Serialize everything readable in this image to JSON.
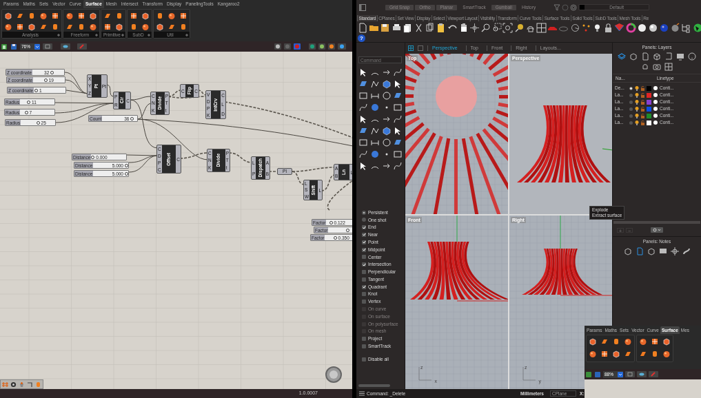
{
  "gh": {
    "tabs": [
      {
        "label": "Params",
        "selected": false
      },
      {
        "label": "Maths",
        "selected": false
      },
      {
        "label": "Sets",
        "selected": false
      },
      {
        "label": "Vector",
        "selected": false
      },
      {
        "label": "Curve",
        "selected": false
      },
      {
        "label": "Surface",
        "selected": true
      },
      {
        "label": "Mesh",
        "selected": false
      },
      {
        "label": "Intersect",
        "selected": false
      },
      {
        "label": "Transform",
        "selected": false
      },
      {
        "label": "Display",
        "selected": false
      },
      {
        "label": "PanelingTools",
        "selected": false
      },
      {
        "label": "Kangaroo2",
        "selected": false
      }
    ],
    "ribbon_groups": [
      {
        "label": "Analysis"
      },
      {
        "label": "Freeform"
      },
      {
        "label": "Primitive"
      },
      {
        "label": "SubD"
      },
      {
        "label": "Util"
      }
    ],
    "zoom": "76%",
    "sliders": [
      {
        "label": "Z coordinate",
        "value": "32",
        "level": 0.64
      },
      {
        "label": "Z coordinate",
        "value": "19",
        "level": 0.38
      },
      {
        "label": "Z coordinate",
        "value": "1",
        "level": 0.02
      },
      {
        "label": "Radius",
        "value": "11",
        "level": 0.22
      },
      {
        "label": "Radius",
        "value": "7",
        "level": 0.14
      },
      {
        "label": "Radius",
        "value": "25",
        "level": 0.5
      },
      {
        "label": "Count",
        "value": "36",
        "level": 0.9
      },
      {
        "label": "Distance",
        "value": "0.000",
        "level": 0
      },
      {
        "label": "Distance",
        "value": "5.000",
        "level": 1
      },
      {
        "label": "Distance",
        "value": "5.000",
        "level": 1
      },
      {
        "label": "Factor",
        "value": "0.122",
        "level": 0.12
      },
      {
        "label": "Factor",
        "level": 0.85
      },
      {
        "label": "Factor",
        "value": "0.350",
        "level": 0.35
      }
    ],
    "components": [
      {
        "kind": "component",
        "name": "Pt",
        "inputs": [
          "X",
          "Y",
          "Z"
        ],
        "outputs": [
          "Pt"
        ]
      },
      {
        "kind": "component",
        "name": "Cir",
        "inputs": [
          "P",
          "R"
        ],
        "outputs": [
          "C"
        ]
      },
      {
        "kind": "component",
        "name": "Divide",
        "inputs": [
          "C",
          "N",
          "K"
        ],
        "outputs": [
          "P",
          "T",
          "t"
        ]
      },
      {
        "kind": "component",
        "name": "Flip",
        "inputs": [
          "C"
        ],
        "outputs": [
          "C"
        ]
      },
      {
        "kind": "component",
        "name": "IntCrv",
        "inputs": [
          "V",
          "D",
          "P",
          "K"
        ],
        "outputs": [
          "C",
          "L",
          "D"
        ]
      },
      {
        "kind": "component",
        "name": "Offset",
        "inputs": [
          "C",
          "D",
          "P",
          "C"
        ],
        "outputs": [
          "C"
        ]
      },
      {
        "kind": "component",
        "name": "Divide",
        "inputs": [
          "C",
          "N",
          "K"
        ],
        "outputs": [
          "P",
          "T",
          "t"
        ]
      },
      {
        "kind": "component",
        "name": "Dispatch",
        "inputs": [
          "L",
          "P"
        ],
        "outputs": [
          "A",
          "B"
        ]
      },
      {
        "kind": "param",
        "name": "Pl"
      },
      {
        "kind": "component",
        "name": "Shift",
        "inputs": [
          "L",
          "S",
          "W"
        ],
        "outputs": [
          "L"
        ]
      },
      {
        "kind": "component",
        "name": "Ln",
        "inputs": [
          "A",
          "B"
        ],
        "outputs": [
          "L"
        ]
      }
    ],
    "version": "1.0.0007"
  },
  "rhino": {
    "toggles": [
      {
        "label": "Grid Snap",
        "on": true
      },
      {
        "label": "Ortho",
        "on": true
      },
      {
        "label": "Planar",
        "on": true
      },
      {
        "label": "SmartTrack",
        "on": false
      },
      {
        "label": "Gumball",
        "on": true
      },
      {
        "label": "History",
        "on": false
      }
    ],
    "layer_field": "Default",
    "toolbar_tabs": [
      {
        "label": "Standard",
        "selected": true
      },
      {
        "label": "CPlanes",
        "selected": false
      },
      {
        "label": "Set View",
        "selected": false
      },
      {
        "label": "Display",
        "selected": false
      },
      {
        "label": "Select",
        "selected": false
      },
      {
        "label": "Viewport Layout",
        "selected": false
      },
      {
        "label": "Visibility",
        "selected": false
      },
      {
        "label": "Transform",
        "selected": false
      },
      {
        "label": "Curve Tools",
        "selected": false
      },
      {
        "label": "Surface Tools",
        "selected": false
      },
      {
        "label": "Solid Tools",
        "selected": false
      },
      {
        "label": "SubD Tools",
        "selected": false
      },
      {
        "label": "Mesh Tools",
        "selected": false
      },
      {
        "label": "Re",
        "selected": false
      }
    ],
    "help_button": "?",
    "command_placeholder": "Command",
    "viewport_tabs": [
      {
        "label": "Perspective",
        "selected": true
      },
      {
        "label": "Top",
        "selected": false
      },
      {
        "label": "Front",
        "selected": false
      },
      {
        "label": "Right",
        "selected": false
      },
      {
        "label": "Layouts...",
        "selected": false
      }
    ],
    "viewports": [
      {
        "label": "Top"
      },
      {
        "label": "Perspective"
      },
      {
        "label": "Front",
        "axes": [
          "z",
          "x"
        ]
      },
      {
        "label": "Right",
        "axes": [
          "z",
          "y"
        ]
      }
    ],
    "osnaps": [
      {
        "kind": "radio",
        "label": "Persistent",
        "checked": true,
        "disabled": false
      },
      {
        "kind": "radio",
        "label": "One shot",
        "checked": false,
        "disabled": false
      },
      {
        "kind": "check",
        "label": "End",
        "checked": true,
        "disabled": false
      },
      {
        "kind": "check",
        "label": "Near",
        "checked": true,
        "disabled": false
      },
      {
        "kind": "check",
        "label": "Point",
        "checked": true,
        "disabled": false
      },
      {
        "kind": "check",
        "label": "Midpoint",
        "checked": true,
        "disabled": false
      },
      {
        "kind": "check",
        "label": "Center",
        "checked": false,
        "disabled": false
      },
      {
        "kind": "check",
        "label": "Intersection",
        "checked": true,
        "disabled": false
      },
      {
        "kind": "check",
        "label": "Perpendicular",
        "checked": false,
        "disabled": false
      },
      {
        "kind": "check",
        "label": "Tangent",
        "checked": false,
        "disabled": false
      },
      {
        "kind": "check",
        "label": "Quadrant",
        "checked": true,
        "disabled": false
      },
      {
        "kind": "check",
        "label": "Knot",
        "checked": false,
        "disabled": false
      },
      {
        "kind": "check",
        "label": "Vertex",
        "checked": false,
        "disabled": false
      },
      {
        "kind": "check",
        "label": "On curve",
        "checked": false,
        "disabled": true
      },
      {
        "kind": "check",
        "label": "On surface",
        "checked": false,
        "disabled": true
      },
      {
        "kind": "check",
        "label": "On polysurface",
        "checked": false,
        "disabled": true
      },
      {
        "kind": "check",
        "label": "On mesh",
        "checked": false,
        "disabled": true
      },
      {
        "kind": "check",
        "label": "Project",
        "checked": false,
        "disabled": false
      },
      {
        "kind": "check",
        "label": "SmartTrack",
        "checked": false,
        "disabled": false
      }
    ],
    "disable_all": {
      "label": "Disable all",
      "checked": false
    },
    "layers_panel": {
      "title": "Panels: Layers",
      "columns": [
        "Na...",
        "Linetype"
      ],
      "rows": [
        {
          "name": "De...",
          "current": true,
          "color": "#000000",
          "linetype": "Conti..."
        },
        {
          "name": "La...",
          "current": false,
          "color": "#e02424",
          "linetype": "Conti..."
        },
        {
          "name": "La...",
          "current": false,
          "color": "#8a3fd0",
          "linetype": "Conti..."
        },
        {
          "name": "La...",
          "current": false,
          "color": "#0a4ee6",
          "linetype": "Conti..."
        },
        {
          "name": "La...",
          "current": false,
          "color": "#1f8a2a",
          "linetype": "Conti..."
        },
        {
          "name": "La...",
          "current": false,
          "color": "#ffffff",
          "linetype": "Conti..."
        }
      ],
      "add": "+",
      "remove": "−"
    },
    "notes_panel": {
      "title": "Panels: Notes"
    },
    "tooltip": [
      "Explode",
      "Extract surface"
    ],
    "status": {
      "command": "Command: _Delete",
      "units": "Millimeters",
      "cplane": "CPlane",
      "x_label": "X:"
    }
  },
  "mini_gh": {
    "tabs": [
      {
        "label": "Params",
        "selected": false
      },
      {
        "label": "Maths",
        "selected": false
      },
      {
        "label": "Sets",
        "selected": false
      },
      {
        "label": "Vector",
        "selected": false
      },
      {
        "label": "Curve",
        "selected": false
      },
      {
        "label": "Surface",
        "selected": true
      },
      {
        "label": "Mes",
        "selected": false
      }
    ],
    "zoom": "88%"
  }
}
